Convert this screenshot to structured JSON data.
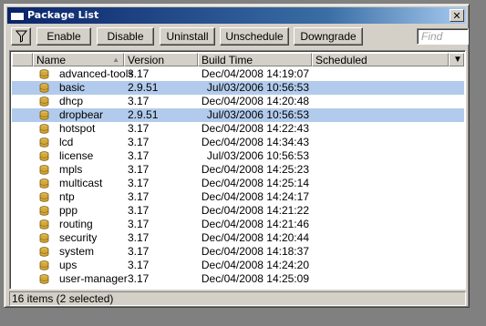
{
  "window": {
    "title": "Package List",
    "close_glyph": "✕"
  },
  "toolbar": {
    "filter_icon": "filter-icon",
    "buttons": [
      "Enable",
      "Disable",
      "Uninstall",
      "Unschedule",
      "Downgrade"
    ],
    "find_placeholder": "Find"
  },
  "table": {
    "columns": [
      "Name",
      "Version",
      "Build Time",
      "Scheduled"
    ],
    "rows": [
      {
        "name": "advanced-tools",
        "version": "3.17",
        "build_time": "Dec/04/2008 14:19:07",
        "scheduled": "",
        "selected": false
      },
      {
        "name": "basic",
        "version": "2.9.51",
        "build_time": "Jul/03/2006 10:56:53",
        "scheduled": "",
        "selected": true
      },
      {
        "name": "dhcp",
        "version": "3.17",
        "build_time": "Dec/04/2008 14:20:48",
        "scheduled": "",
        "selected": false
      },
      {
        "name": "dropbear",
        "version": "2.9.51",
        "build_time": "Jul/03/2006 10:56:53",
        "scheduled": "",
        "selected": true
      },
      {
        "name": "hotspot",
        "version": "3.17",
        "build_time": "Dec/04/2008 14:22:43",
        "scheduled": "",
        "selected": false
      },
      {
        "name": "lcd",
        "version": "3.17",
        "build_time": "Dec/04/2008 14:34:43",
        "scheduled": "",
        "selected": false
      },
      {
        "name": "license",
        "version": "3.17",
        "build_time": "Jul/03/2006 10:56:53",
        "scheduled": "",
        "selected": false
      },
      {
        "name": "mpls",
        "version": "3.17",
        "build_time": "Dec/04/2008 14:25:23",
        "scheduled": "",
        "selected": false
      },
      {
        "name": "multicast",
        "version": "3.17",
        "build_time": "Dec/04/2008 14:25:14",
        "scheduled": "",
        "selected": false
      },
      {
        "name": "ntp",
        "version": "3.17",
        "build_time": "Dec/04/2008 14:24:17",
        "scheduled": "",
        "selected": false
      },
      {
        "name": "ppp",
        "version": "3.17",
        "build_time": "Dec/04/2008 14:21:22",
        "scheduled": "",
        "selected": false
      },
      {
        "name": "routing",
        "version": "3.17",
        "build_time": "Dec/04/2008 14:21:46",
        "scheduled": "",
        "selected": false
      },
      {
        "name": "security",
        "version": "3.17",
        "build_time": "Dec/04/2008 14:20:44",
        "scheduled": "",
        "selected": false
      },
      {
        "name": "system",
        "version": "3.17",
        "build_time": "Dec/04/2008 14:18:37",
        "scheduled": "",
        "selected": false
      },
      {
        "name": "ups",
        "version": "3.17",
        "build_time": "Dec/04/2008 14:24:20",
        "scheduled": "",
        "selected": false
      },
      {
        "name": "user-manager",
        "version": "3.17",
        "build_time": "Dec/04/2008 14:25:09",
        "scheduled": "",
        "selected": false
      }
    ]
  },
  "status": {
    "text": "16 items (2 selected)"
  },
  "colors": {
    "selection": "#b2cbec",
    "title_bar": "#0a246a",
    "window_bg": "#d4d0c8"
  }
}
